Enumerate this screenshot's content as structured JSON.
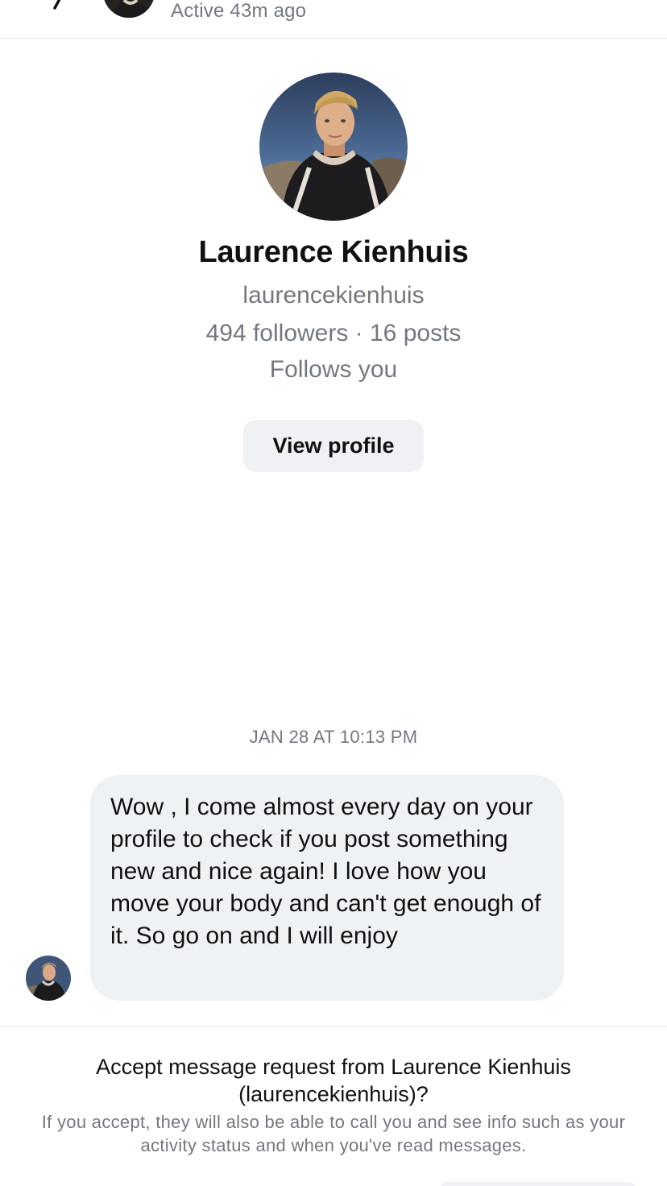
{
  "header": {
    "back_icon": "chevron-left-icon",
    "status": "Active 43m ago"
  },
  "profile": {
    "name": "Laurence Kienhuis",
    "handle": "laurencekienhuis",
    "stats": "494 followers · 16 posts",
    "relationship": "Follows you",
    "view_profile_label": "View profile"
  },
  "thread": {
    "timestamp": "JAN 28 AT 10:13 PM",
    "messages": [
      {
        "text": "Wow , I come almost every day on your profile to check if you post something new and nice again! I love how you move your body and can't get enough of it. So go on and I will enjoy"
      }
    ]
  },
  "request": {
    "title": "Accept message request from Laurence Kienhuis (laurencekienhuis)?",
    "description": "If you accept, they will also be able to call you and see info such as your activity status and when you've read messages."
  },
  "colors": {
    "secondary_text": "#737880",
    "bubble_bg": "#eff2f5",
    "button_bg": "#eff1f4",
    "divider": "#e4e6eb"
  }
}
